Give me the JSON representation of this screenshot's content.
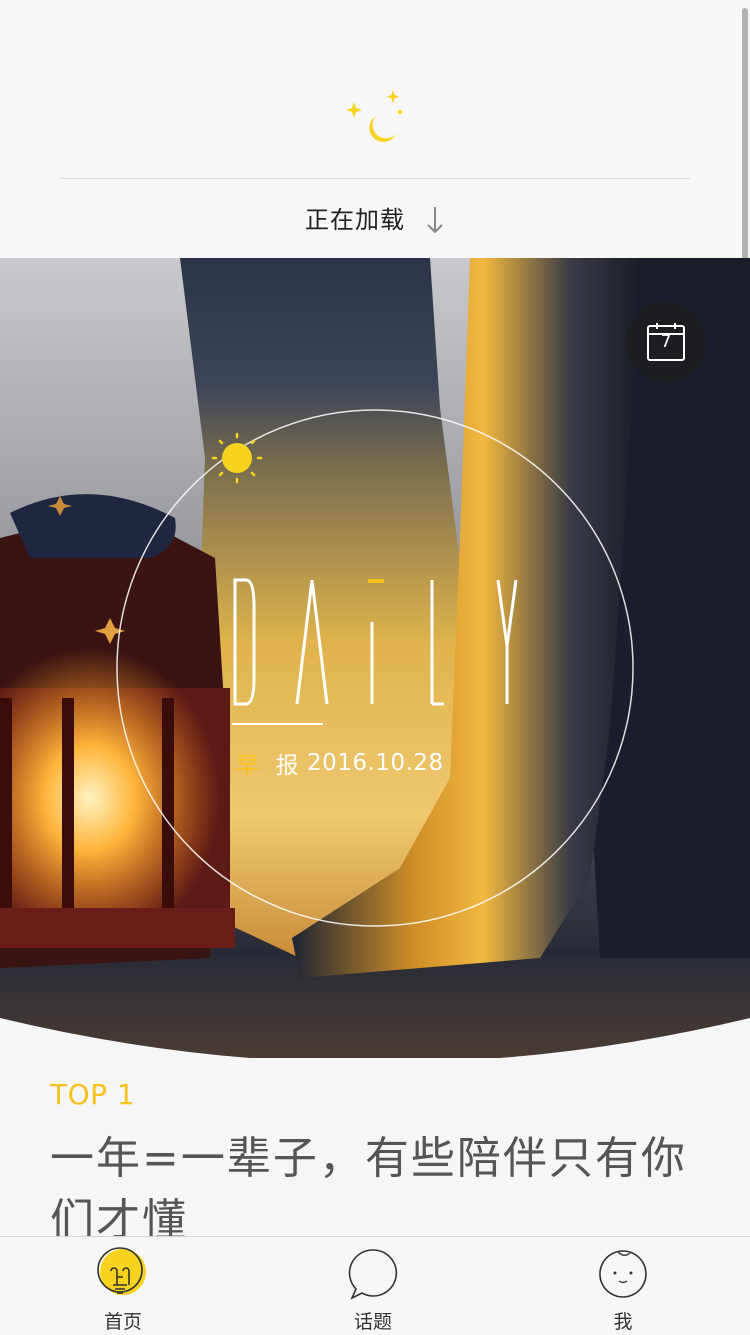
{
  "refresh": {
    "status_text": "正在加载",
    "moon_icon": "moon-stars-icon",
    "arrow_icon": "arrow-down-icon"
  },
  "hero": {
    "logo_text": "DAiLY",
    "date_prefix": "早",
    "date_mid": "报",
    "date_value": "2016.10.28",
    "calendar_day": "7",
    "calendar_icon": "calendar-icon",
    "sun_icon": "sun-icon"
  },
  "article": {
    "tag": "TOP 1",
    "title": "一年=一辈子，有些陪伴只有你们才懂"
  },
  "tabs": [
    {
      "label": "首页",
      "icon": "lightbulb-icon",
      "active": true
    },
    {
      "label": "话题",
      "icon": "chat-bubble-icon",
      "active": false
    },
    {
      "label": "我",
      "icon": "face-icon",
      "active": false
    }
  ],
  "colors": {
    "accent": "#f7c21e",
    "background": "#f6f6f6",
    "title_text": "#555555"
  }
}
